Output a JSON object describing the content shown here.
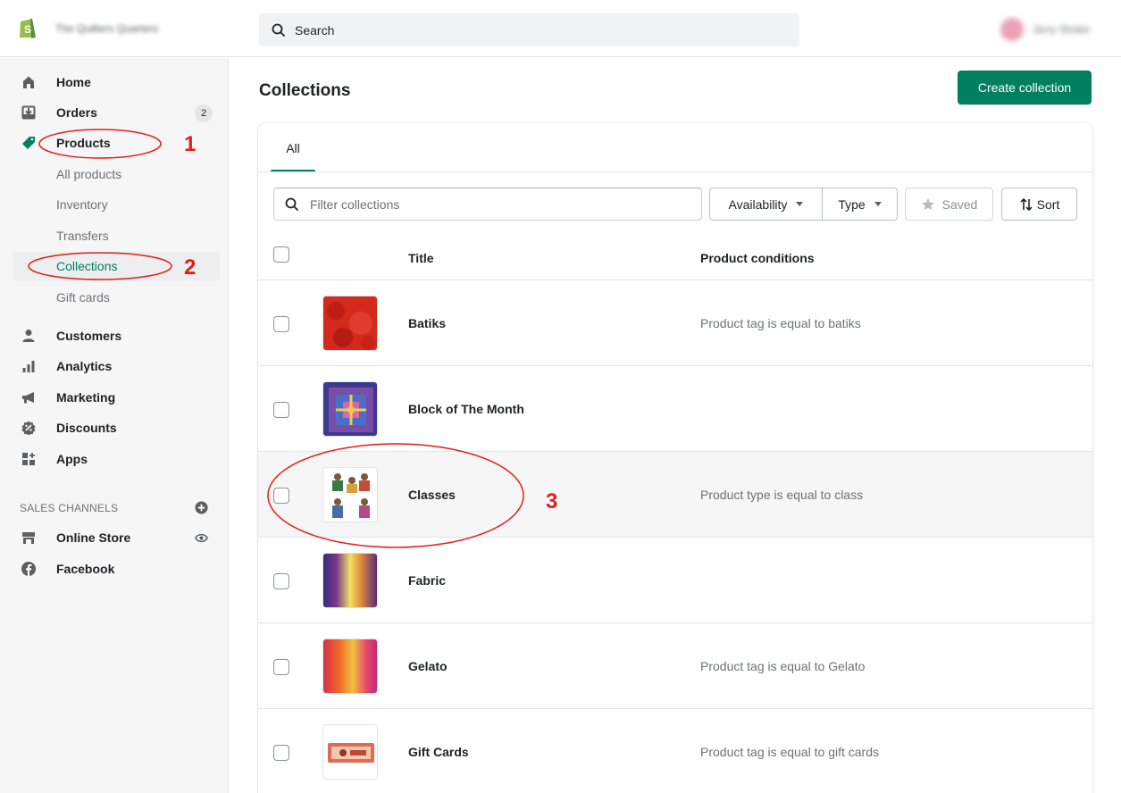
{
  "topbar": {
    "store_name": "The Quilters Quarters",
    "search_placeholder": "Search",
    "user_name": "Jerry Shoke"
  },
  "sidebar": {
    "items": [
      {
        "label": "Home",
        "icon": "home-icon"
      },
      {
        "label": "Orders",
        "icon": "orders-icon",
        "badge": "2"
      },
      {
        "label": "Products",
        "icon": "tag-icon"
      },
      {
        "label": "All products"
      },
      {
        "label": "Inventory"
      },
      {
        "label": "Transfers"
      },
      {
        "label": "Collections"
      },
      {
        "label": "Gift cards"
      },
      {
        "label": "Customers",
        "icon": "person-icon"
      },
      {
        "label": "Analytics",
        "icon": "analytics-icon"
      },
      {
        "label": "Marketing",
        "icon": "megaphone-icon"
      },
      {
        "label": "Discounts",
        "icon": "discount-icon"
      },
      {
        "label": "Apps",
        "icon": "apps-icon"
      }
    ],
    "sales_channels_title": "SALES CHANNELS",
    "channels": [
      {
        "label": "Online Store",
        "icon": "store-icon"
      },
      {
        "label": "Facebook",
        "icon": "facebook-icon"
      }
    ]
  },
  "main": {
    "title": "Collections",
    "create_button": "Create collection",
    "tabs": [
      {
        "label": "All"
      }
    ],
    "filter_placeholder": "Filter collections",
    "availability_label": "Availability",
    "type_label": "Type",
    "saved_label": "Saved",
    "sort_label": "Sort",
    "columns": {
      "title": "Title",
      "conditions": "Product conditions"
    },
    "rows": [
      {
        "title": "Batiks",
        "condition": "Product tag is equal to batiks",
        "thumb": "red-batik"
      },
      {
        "title": "Block of The Month",
        "condition": "",
        "thumb": "purple-quilt"
      },
      {
        "title": "Classes",
        "condition": "Product type is equal to class",
        "thumb": "quilters-figures"
      },
      {
        "title": "Fabric",
        "condition": "",
        "thumb": "purple-yellow-gradient"
      },
      {
        "title": "Gelato",
        "condition": "Product tag is equal to Gelato",
        "thumb": "orange-pink-gradient"
      },
      {
        "title": "Gift Cards",
        "condition": "Product tag is equal to gift cards",
        "thumb": "gift-card"
      }
    ]
  },
  "annotations": [
    "1",
    "2",
    "3"
  ],
  "colors": {
    "accent": "#008060",
    "annotation": "#e51c1c"
  }
}
